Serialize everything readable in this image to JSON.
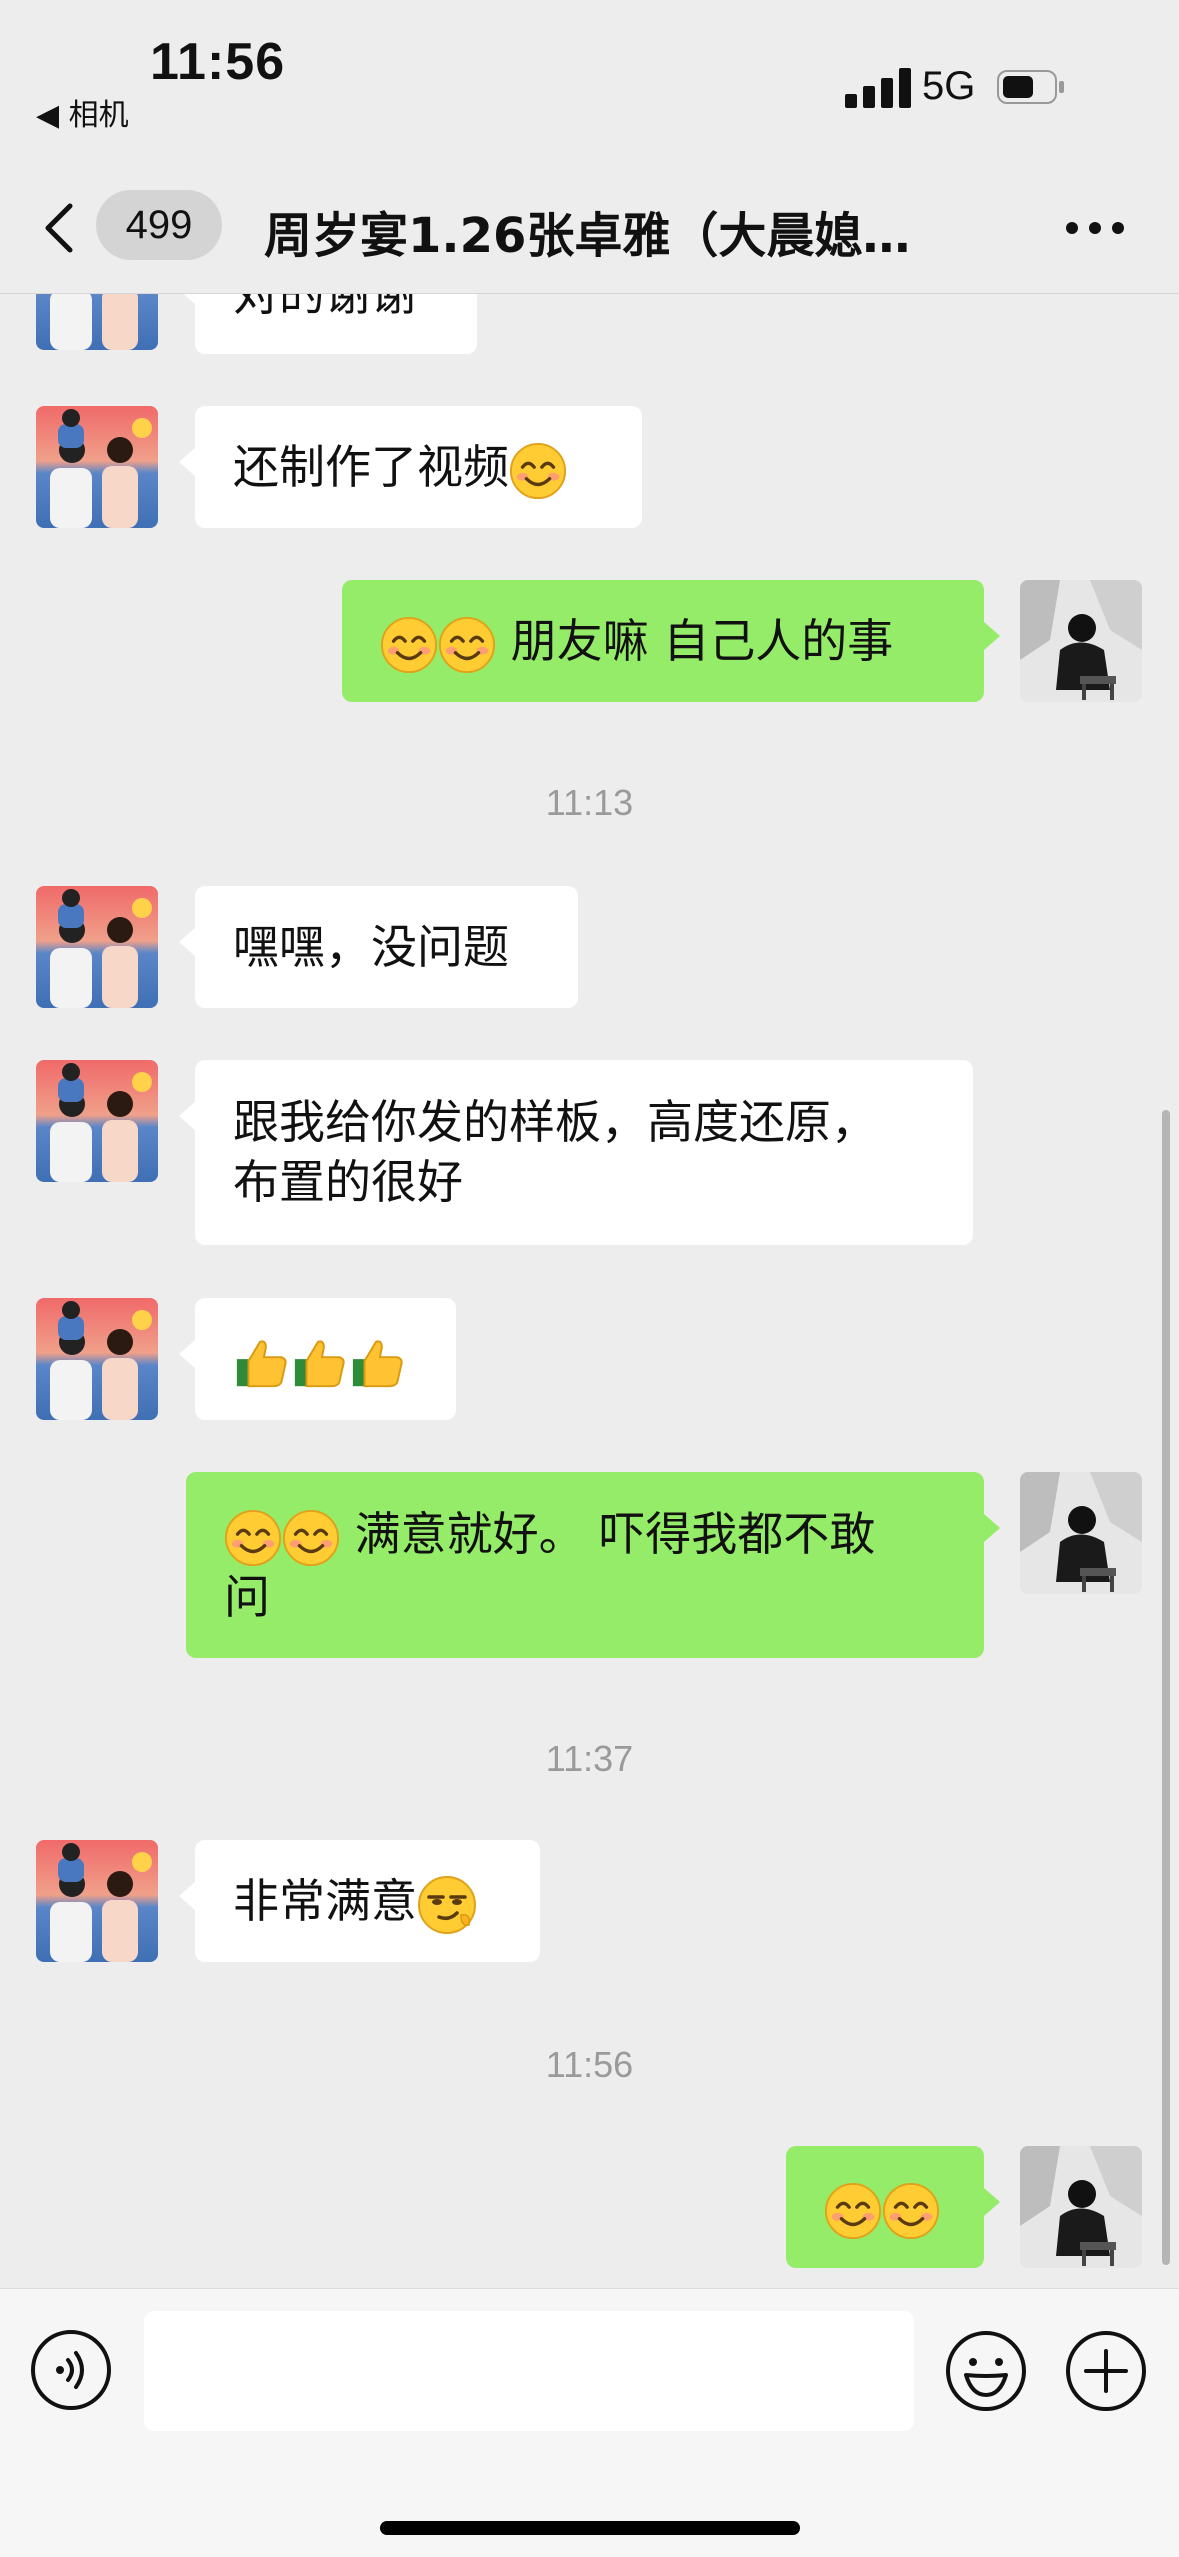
{
  "status": {
    "time": "11:56",
    "back_app": "◀ 相机",
    "network": "5G"
  },
  "nav": {
    "unread_count": "499",
    "title": "周岁宴1.26张卓雅（大晨媳…"
  },
  "messages": {
    "m0": {
      "text": "对的谢谢"
    },
    "m1": {
      "text": "还制作了视频"
    },
    "m2": {
      "text": " 朋友嘛 自己人的事"
    },
    "m3": {
      "text": "嘿嘿，没问题"
    },
    "m4": {
      "line1": "跟我给你发的样板，高度还原，",
      "line2": "布置的很好"
    },
    "m6": {
      "line1": " 满意就好。 吓得我都不敢",
      "line2": "问"
    },
    "m7": {
      "text": "非常满意"
    }
  },
  "timestamps": {
    "t1": "11:13",
    "t2": "11:37",
    "t3": "11:56"
  },
  "input": {
    "value": ""
  },
  "colors": {
    "bubble_sent": "#95ec69",
    "bubble_received": "#ffffff",
    "background": "#ededed"
  }
}
